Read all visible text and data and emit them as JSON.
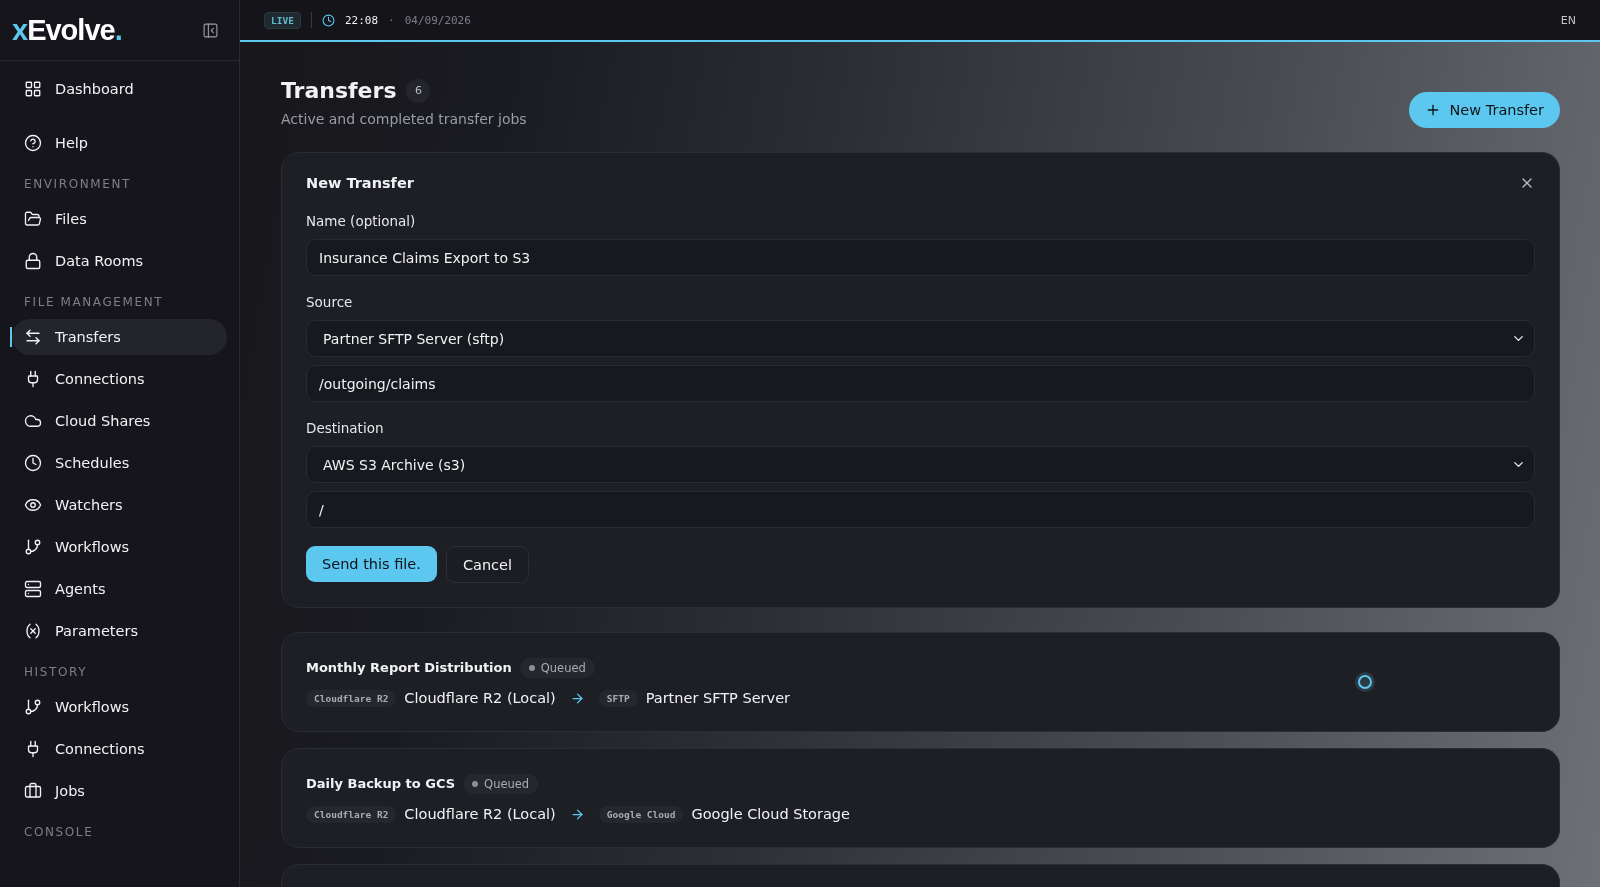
{
  "brand": {
    "prefix": "x",
    "name": "Evolve",
    "dot": "."
  },
  "sidebar": {
    "top_items": [
      {
        "label": "Dashboard",
        "selected": false
      },
      {
        "label": "Help",
        "selected": false
      }
    ],
    "sections": [
      {
        "title": "ENVIRONMENT",
        "items": [
          {
            "label": "Files",
            "selected": false
          },
          {
            "label": "Data Rooms",
            "selected": false
          }
        ]
      },
      {
        "title": "FILE MANAGEMENT",
        "items": [
          {
            "label": "Transfers",
            "selected": true
          },
          {
            "label": "Connections",
            "selected": false
          },
          {
            "label": "Cloud Shares",
            "selected": false
          },
          {
            "label": "Schedules",
            "selected": false
          },
          {
            "label": "Watchers",
            "selected": false
          },
          {
            "label": "Workflows",
            "selected": false
          },
          {
            "label": "Agents",
            "selected": false
          },
          {
            "label": "Parameters",
            "selected": false
          }
        ]
      },
      {
        "title": "HISTORY",
        "items": [
          {
            "label": "Workflows",
            "selected": false
          },
          {
            "label": "Connections",
            "selected": false
          },
          {
            "label": "Jobs",
            "selected": false
          }
        ]
      },
      {
        "title": "CONSOLE"
      }
    ]
  },
  "topbar": {
    "live": "LIVE",
    "time": "22:08",
    "separator": "·",
    "date": "04/09/2026",
    "language": "EN"
  },
  "page": {
    "title": "Transfers",
    "count": "6",
    "subtitle": "Active and completed transfer jobs",
    "new_button": "New Transfer"
  },
  "form": {
    "title": "New Transfer",
    "groups": [
      {
        "label": "Name (optional)",
        "controls": [
          {
            "kind": "input",
            "value": "Insurance Claims Export to S3"
          }
        ]
      },
      {
        "label": "Source",
        "controls": [
          {
            "kind": "select",
            "value": "Partner SFTP Server (sftp)"
          },
          {
            "kind": "input",
            "value": "/outgoing/claims"
          }
        ]
      },
      {
        "label": "Destination",
        "controls": [
          {
            "kind": "select",
            "value": "AWS S3 Archive (s3)"
          },
          {
            "kind": "input",
            "value": "/"
          }
        ]
      }
    ],
    "submit": "Send this file.",
    "cancel": "Cancel"
  },
  "transfers": [
    {
      "name": "Monthly Report Distribution",
      "status": "Queued",
      "source_tag": "Cloudflare R2",
      "source": "Cloudflare R2 (Local)",
      "dest_tag": "SFTP",
      "dest": "Partner SFTP Server",
      "loading": true
    },
    {
      "name": "Daily Backup to GCS",
      "status": "Queued",
      "source_tag": "Cloudflare R2",
      "source": "Cloudflare R2 (Local)",
      "dest_tag": "Google Cloud",
      "dest": "Google Cloud Storage",
      "loading": false
    }
  ]
}
